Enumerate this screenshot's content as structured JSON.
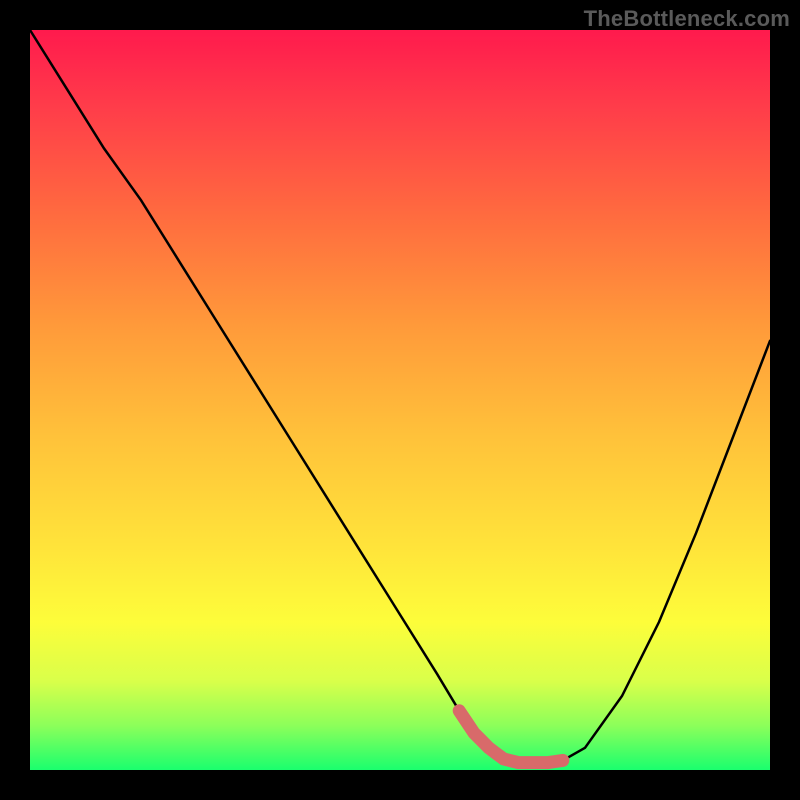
{
  "watermark": "TheBottleneck.com",
  "chart_data": {
    "type": "line",
    "title": "",
    "xlabel": "",
    "ylabel": "",
    "xlim": [
      0,
      100
    ],
    "ylim": [
      0,
      100
    ],
    "x": [
      0,
      5,
      10,
      15,
      20,
      25,
      30,
      35,
      40,
      45,
      50,
      55,
      58,
      60,
      62,
      64,
      66,
      68,
      70,
      72,
      75,
      80,
      85,
      90,
      95,
      100
    ],
    "values": [
      100,
      92,
      84,
      77,
      69,
      61,
      53,
      45,
      37,
      29,
      21,
      13,
      8,
      5,
      3,
      1.5,
      1,
      1,
      1,
      1.3,
      3,
      10,
      20,
      32,
      45,
      58
    ],
    "marker_segment": {
      "x_start": 58,
      "x_end": 72,
      "color": "#d86a6a"
    },
    "curve_color": "#000000",
    "background_gradient": [
      "#ff1a4d",
      "#ffe43a",
      "#1aff6e"
    ]
  }
}
